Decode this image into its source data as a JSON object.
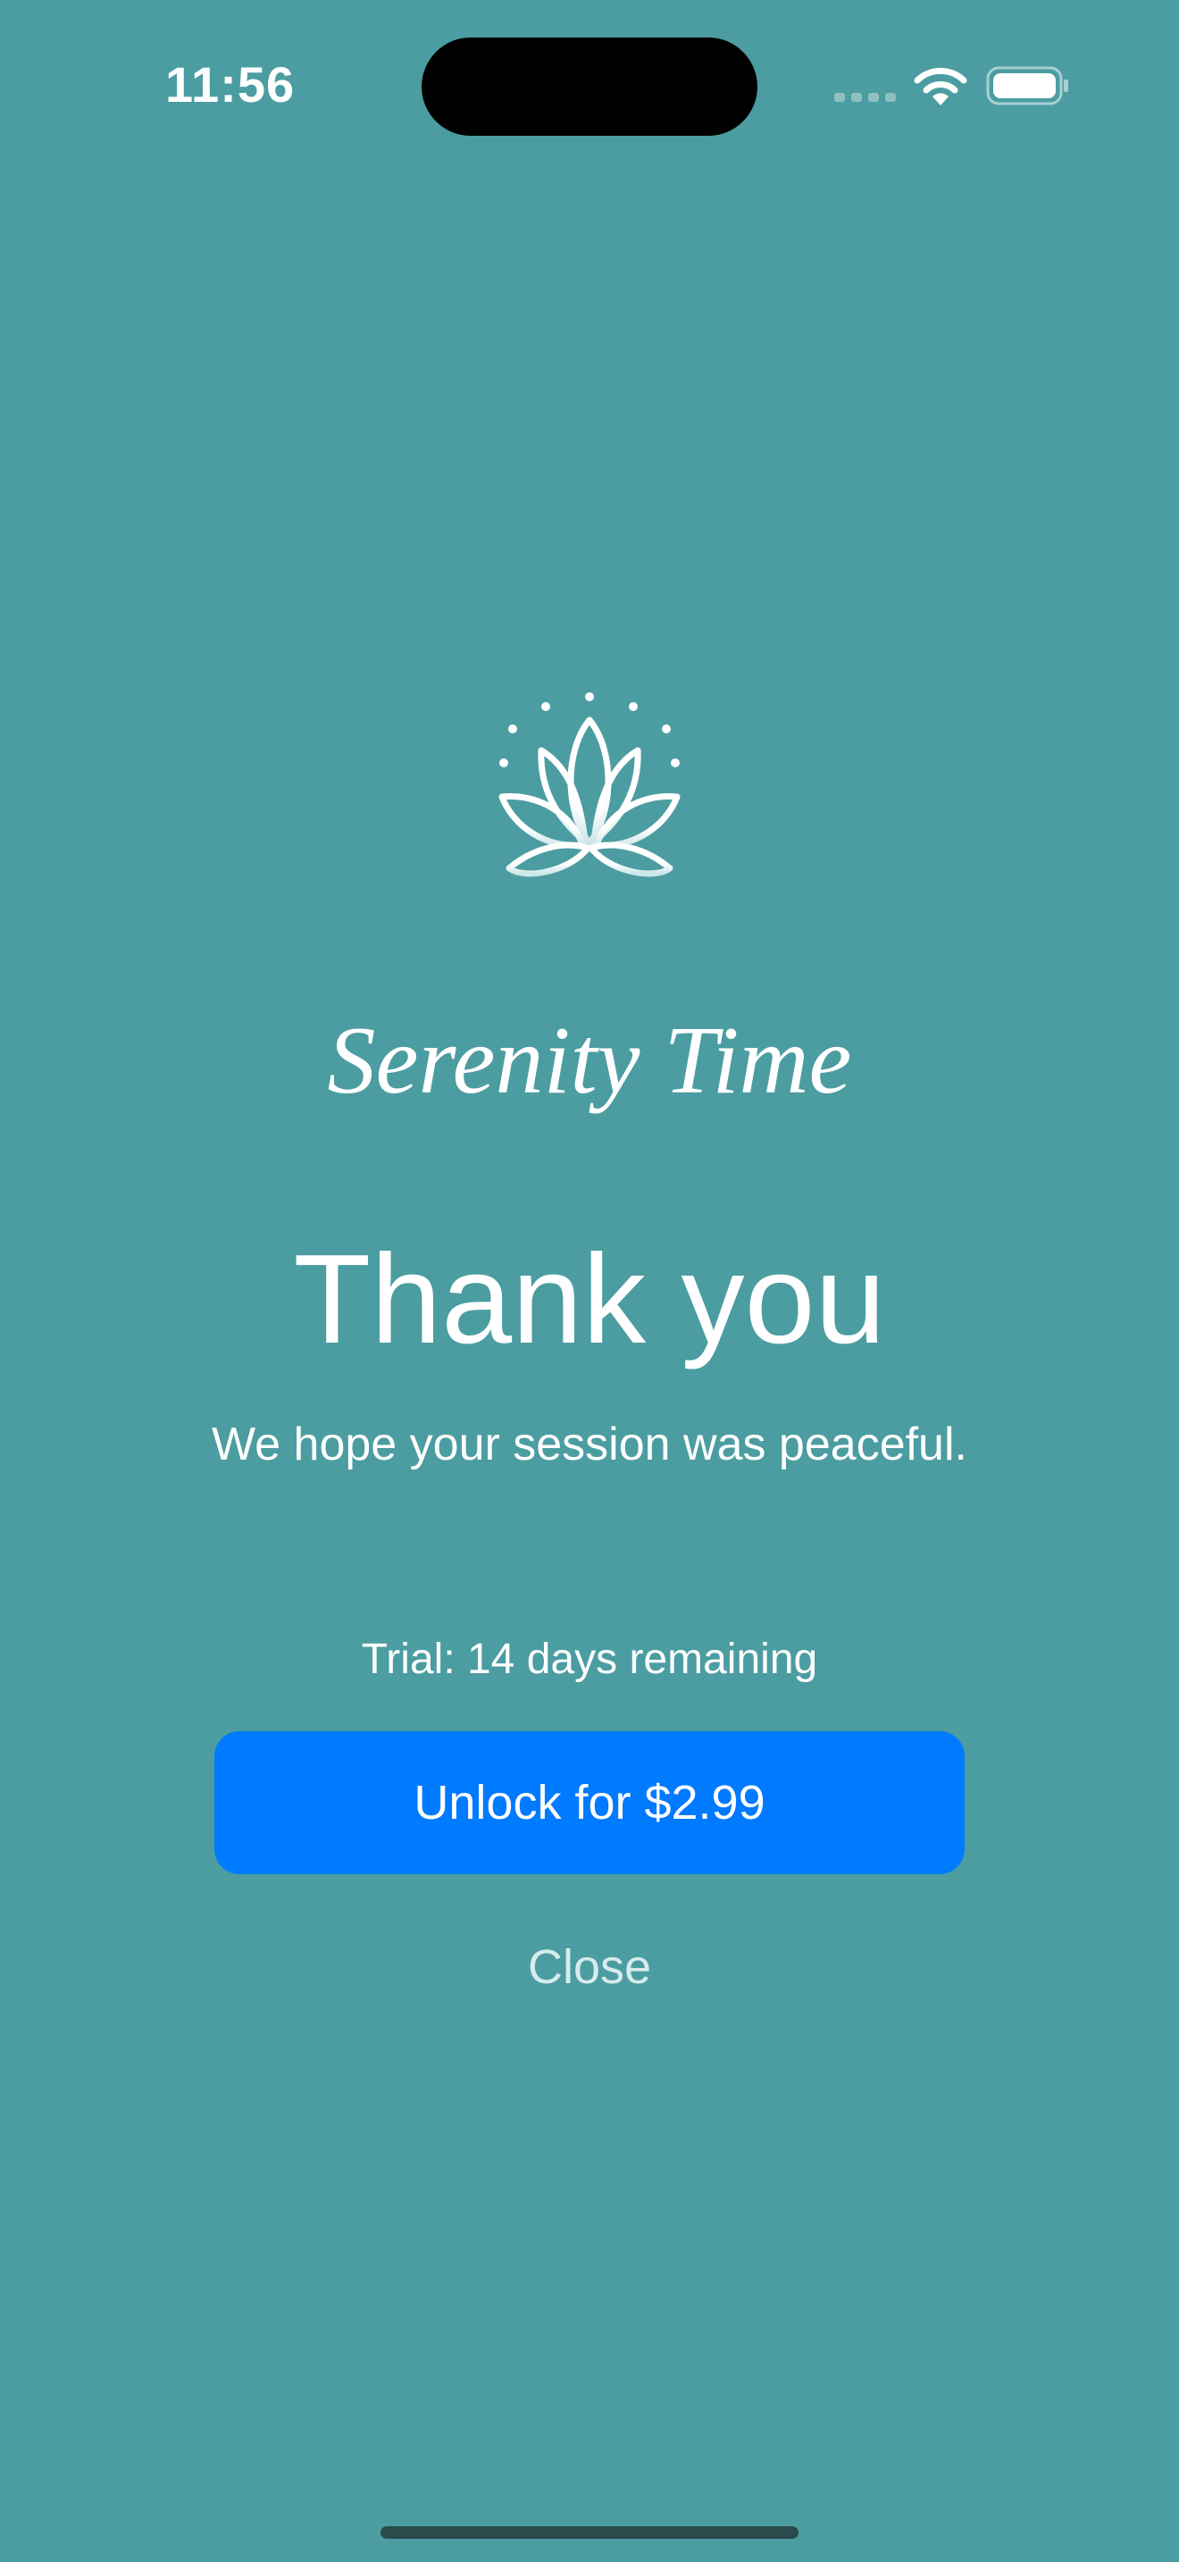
{
  "status_bar": {
    "time": "11:56",
    "icons": [
      "cellular-signal-icon",
      "wifi-icon",
      "battery-icon"
    ]
  },
  "logo": {
    "icon": "lotus-icon"
  },
  "brand": {
    "name": "Serenity Time"
  },
  "content": {
    "headline": "Thank you",
    "subtitle": "We hope your session was peaceful.",
    "trial": "Trial: 14 days remaining"
  },
  "actions": {
    "unlock_label": "Unlock for $2.99",
    "close_label": "Close"
  },
  "colors": {
    "background": "#4b9da1",
    "primary_button": "#007aff",
    "text": "#ffffff"
  }
}
